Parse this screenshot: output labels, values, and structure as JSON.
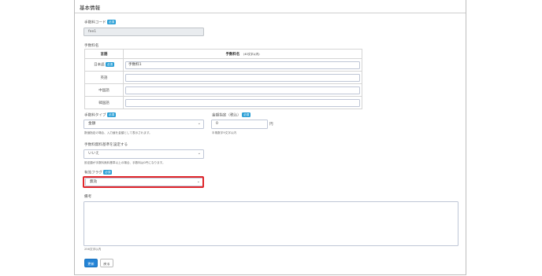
{
  "header": {
    "title": "基本情報"
  },
  "fields": {
    "code": {
      "label": "手数料コード",
      "badge": "必須",
      "value": "fee1"
    },
    "name": {
      "label": "手数料名",
      "col_lang": "言語",
      "col_name": "手数料名",
      "col_name_note": "(40文字以内)",
      "rows": [
        {
          "lang": "日本語",
          "badge": "必須",
          "value": "手数料1"
        },
        {
          "lang": "英語",
          "value": ""
        },
        {
          "lang": "中国語",
          "value": ""
        },
        {
          "lang": "韓国語",
          "value": ""
        }
      ]
    },
    "type": {
      "label": "手数料タイプ",
      "badge": "必須",
      "value": "金額",
      "help": "数値指定の場合、入力値を金額として表示されます。"
    },
    "amount": {
      "label": "金額指定（税込）",
      "badge": "必須",
      "value": "0",
      "unit": "円",
      "help": "半角数字9文字以内"
    },
    "free_condition": {
      "label": "手数料無料基準を設定する",
      "value": "いいえ",
      "help": "設定額が手数料無料基準以上の場合、手数料は0円になります。"
    },
    "valid_flag": {
      "label": "有効フラグ",
      "badge": "必須",
      "value": "無効"
    },
    "note": {
      "label": "備考",
      "help": "256文字以内"
    }
  },
  "buttons": {
    "save": "更新",
    "back": "戻る"
  },
  "colors": {
    "accent": "#2383d6",
    "badge": "#2a9fd6",
    "highlight": "#e0262b"
  }
}
